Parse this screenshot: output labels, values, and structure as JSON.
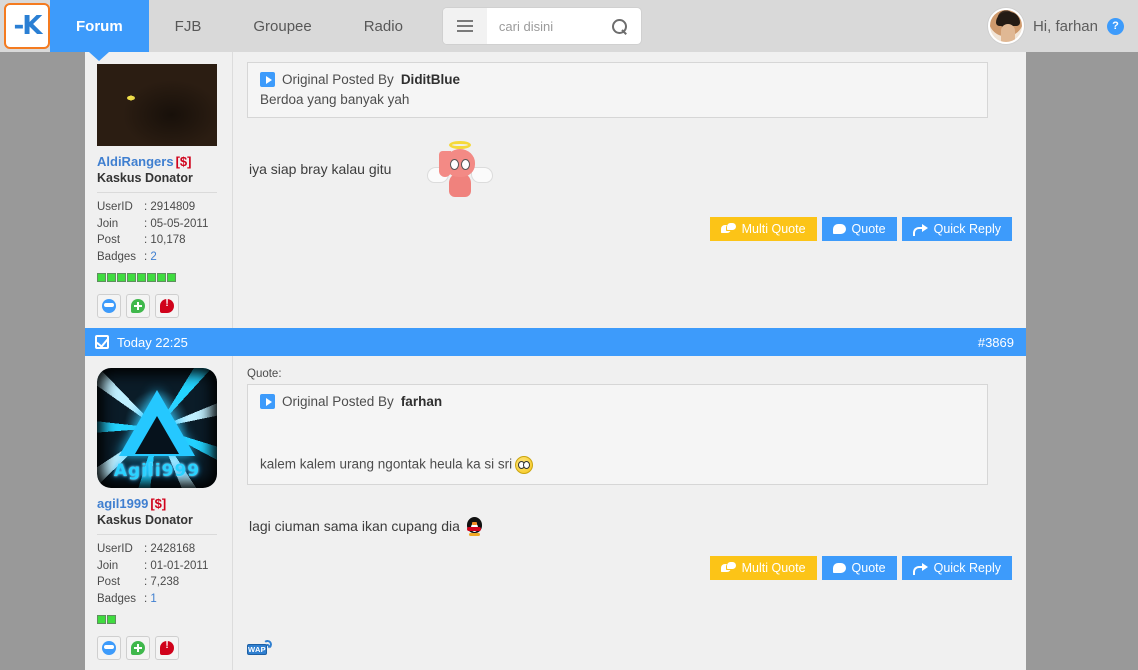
{
  "nav": {
    "logo_alt": "kaskus-logo",
    "tabs": [
      {
        "label": "Forum",
        "active": true
      },
      {
        "label": "FJB",
        "active": false
      },
      {
        "label": "Groupee",
        "active": false
      },
      {
        "label": "Radio",
        "active": false
      }
    ],
    "search": {
      "placeholder": "cari disini",
      "value": ""
    },
    "user": {
      "greeting": "Hi, farhan",
      "help_label": "?"
    }
  },
  "posts": [
    {
      "header": null,
      "author": {
        "name": "AldiRangers",
        "donator_tag": "[$]",
        "title": "Kaskus Donator",
        "avatar_name": "palestine-flag-face-avatar",
        "stats": [
          {
            "key": "UserID",
            "value": "2914809",
            "link": false
          },
          {
            "key": "Join",
            "value": "05-05-2011",
            "link": false
          },
          {
            "key": "Post",
            "value": "10,178",
            "link": false
          },
          {
            "key": "Badges",
            "value": "2",
            "link": true
          }
        ],
        "reputation_blocks": 8
      },
      "quote": {
        "label": null,
        "header_prefix": "Original Posted By",
        "header_user": "DiditBlue",
        "body": "Berdoa yang banyak yah",
        "tall": false
      },
      "message": "iya siap bray kalau gitu",
      "emoticon": "angel-emoticon",
      "wap": false,
      "buttons": [
        {
          "label": "Multi Quote",
          "style": "yellow",
          "icon": "multi-bubble-icon"
        },
        {
          "label": "Quote",
          "style": "blue",
          "icon": "bubble-icon"
        },
        {
          "label": "Quick Reply",
          "style": "blue",
          "icon": "reply-arrow-icon"
        }
      ]
    },
    {
      "header": {
        "timestamp": "Today 22:25",
        "post_number": "#3869",
        "checked": true
      },
      "author": {
        "name": "agil1999",
        "donator_tag": "[$]",
        "title": "Kaskus Donator",
        "avatar_name": "agil1999-tech-avatar",
        "avatar_nick": "Agili999",
        "stats": [
          {
            "key": "UserID",
            "value": "2428168",
            "link": false
          },
          {
            "key": "Join",
            "value": "01-01-2011",
            "link": false
          },
          {
            "key": "Post",
            "value": "7,238",
            "link": false
          },
          {
            "key": "Badges",
            "value": "1",
            "link": true
          }
        ],
        "reputation_blocks": 2
      },
      "quote": {
        "label": "Quote:",
        "header_prefix": "Original Posted By",
        "header_user": "farhan",
        "body": "kalem kalem urang ngontak heula ka si sri",
        "body_emoticon": "shocked-emoticon",
        "tall": true
      },
      "message": "lagi ciuman sama ikan cupang dia",
      "emoticon": "penguin-emoticon",
      "wap": true,
      "wap_label": "WAP",
      "buttons": [
        {
          "label": "Multi Quote",
          "style": "yellow",
          "icon": "multi-bubble-icon"
        },
        {
          "label": "Quote",
          "style": "blue",
          "icon": "bubble-icon"
        },
        {
          "label": "Quick Reply",
          "style": "blue",
          "icon": "reply-arrow-icon"
        }
      ]
    }
  ],
  "colors": {
    "accent_blue": "#3d9bfb",
    "accent_yellow": "#fcc417",
    "donator_red": "#d0021b",
    "page_backdrop": "#999999",
    "panel_bg": "#f0f0f0",
    "nav_bg": "#d9d9d9"
  }
}
